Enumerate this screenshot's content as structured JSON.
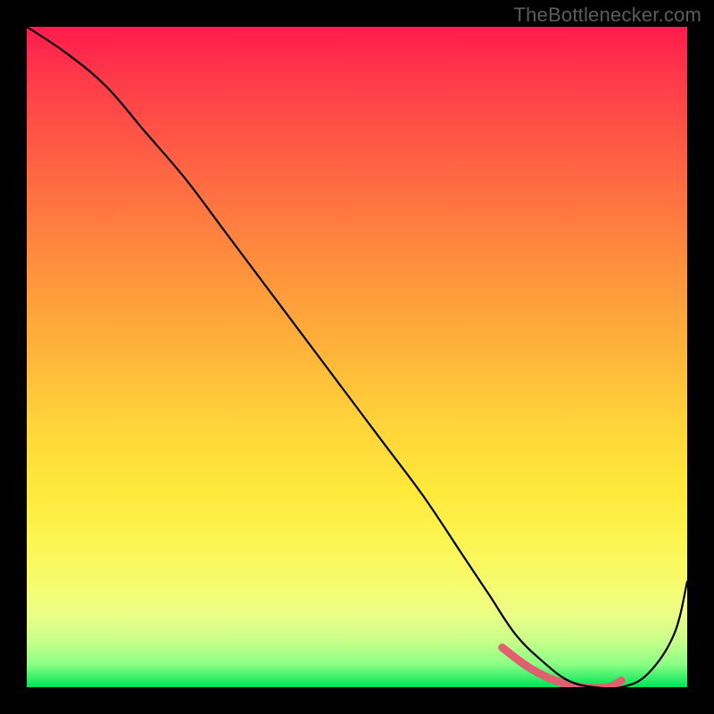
{
  "watermark": "TheBottlenecker.com",
  "chart_data": {
    "type": "line",
    "title": "",
    "xlabel": "",
    "ylabel": "",
    "xlim": [
      0,
      100
    ],
    "ylim": [
      0,
      100
    ],
    "legend": false,
    "grid": false,
    "background": "rainbow-gradient-vertical",
    "series": [
      {
        "name": "bottleneck-curve",
        "color": "#000000",
        "x": [
          0,
          6,
          12,
          18,
          24,
          30,
          36,
          42,
          48,
          54,
          60,
          66,
          70,
          74,
          78,
          82,
          86,
          90,
          94,
          98,
          100
        ],
        "y": [
          100,
          96,
          91,
          84,
          77,
          69,
          61,
          53,
          45,
          37,
          29,
          20,
          14,
          8,
          4,
          1,
          0,
          0,
          2,
          8,
          16
        ]
      },
      {
        "name": "optimal-range-highlight",
        "color": "#e06070",
        "x": [
          72,
          76,
          80,
          84,
          88,
          90
        ],
        "y": [
          6,
          3,
          1,
          0,
          0,
          1
        ]
      }
    ],
    "annotations": []
  }
}
